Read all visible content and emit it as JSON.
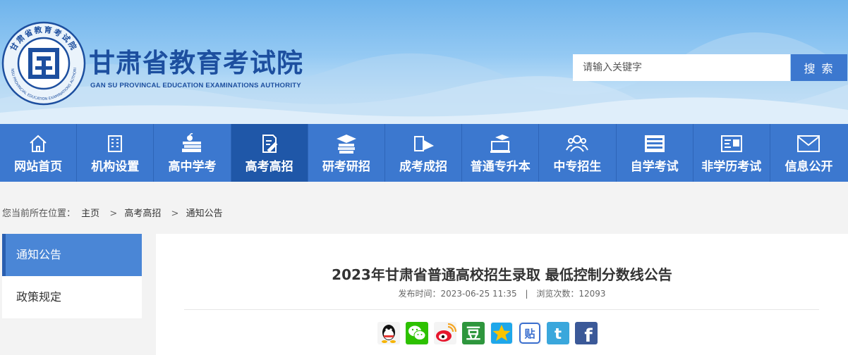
{
  "header": {
    "title": "甘肃省教育考试院",
    "subtitle": "GAN SU PROVINCAL EDUCATION EXAMINATIONS AUTHORITY",
    "logo_ring_text": "甘肃省教育考试院",
    "logo_ring_text_en": "GANSU PROVINCIAL EDUCATION EXAMINATIONS AUTHORITY",
    "search": {
      "placeholder": "请输入关键字",
      "button_label": "搜 索"
    }
  },
  "nav": {
    "items": [
      {
        "label": "网站首页",
        "icon": "home-icon"
      },
      {
        "label": "机构设置",
        "icon": "building-icon"
      },
      {
        "label": "高中学考",
        "icon": "books-apple-icon"
      },
      {
        "label": "高考高招",
        "icon": "document-pen-icon",
        "active": true
      },
      {
        "label": "研考研招",
        "icon": "graduation-books-icon"
      },
      {
        "label": "成考成招",
        "icon": "book-pencil-icon"
      },
      {
        "label": "普通专升本",
        "icon": "graduation-laptop-icon"
      },
      {
        "label": "中专招生",
        "icon": "people-icon"
      },
      {
        "label": "自学考试",
        "icon": "list-icon"
      },
      {
        "label": "非学历考试",
        "icon": "id-card-icon"
      },
      {
        "label": "信息公开",
        "icon": "mail-icon"
      }
    ]
  },
  "breadcrumb": {
    "prefix": "您当前所在位置：",
    "items": [
      "主页",
      "高考高招",
      "通知公告"
    ],
    "separator": ">"
  },
  "sidebar": {
    "items": [
      {
        "label": "通知公告",
        "active": true
      },
      {
        "label": "政策规定",
        "active": false
      }
    ]
  },
  "article": {
    "title": "2023年甘肃省普通高校招生录取 最低控制分数线公告",
    "publish_label": "发布时间：",
    "publish_time": "2023-06-25 11:35",
    "meta_separator": "|",
    "views_label": "浏览次数：",
    "views": "12093"
  },
  "share": {
    "icons": [
      "qq-icon",
      "wechat-icon",
      "weibo-icon",
      "douban-icon",
      "qzone-icon",
      "tieba-icon",
      "twitter-icon",
      "facebook-icon"
    ],
    "labels": {
      "douban": "豆",
      "tieba": "贴",
      "twitter": "t",
      "facebook": "f"
    }
  },
  "colors": {
    "nav_bg": "#3c78cf",
    "nav_active": "#1f57a8",
    "title_blue": "#1d4f9f",
    "sidebar_active": "#4a86d6"
  }
}
